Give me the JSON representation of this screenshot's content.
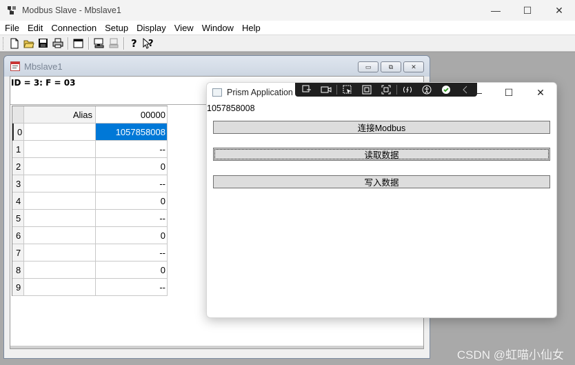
{
  "app": {
    "title": "Modbus Slave - Mbslave1",
    "minimize": "—",
    "maximize": "☐",
    "close": "✕"
  },
  "menu": [
    "File",
    "Edit",
    "Connection",
    "Setup",
    "Display",
    "View",
    "Window",
    "Help"
  ],
  "toolbar": {
    "icons": [
      "new-file-icon",
      "open-folder-icon",
      "save-icon",
      "print-icon",
      "window-icon",
      "connect-icon",
      "disconnect-icon",
      "help-icon",
      "context-help-icon"
    ]
  },
  "child_window": {
    "title": "Mbslave1",
    "id_line": "ID = 3: F = 03",
    "btn_min": "▭",
    "btn_restore": "⧉",
    "btn_close": "✕",
    "grid": {
      "headers": {
        "num": "",
        "alias": "Alias",
        "value": "00000"
      },
      "rows": [
        {
          "num": "0",
          "alias": "",
          "value": "1057858008"
        },
        {
          "num": "1",
          "alias": "",
          "value": "--"
        },
        {
          "num": "2",
          "alias": "",
          "value": "0"
        },
        {
          "num": "3",
          "alias": "",
          "value": "--"
        },
        {
          "num": "4",
          "alias": "",
          "value": "0"
        },
        {
          "num": "5",
          "alias": "",
          "value": "--"
        },
        {
          "num": "6",
          "alias": "",
          "value": "0"
        },
        {
          "num": "7",
          "alias": "",
          "value": "--"
        },
        {
          "num": "8",
          "alias": "",
          "value": "0"
        },
        {
          "num": "9",
          "alias": "",
          "value": "--"
        }
      ]
    }
  },
  "prism": {
    "title": "Prism Application",
    "value": "1057858008",
    "buttons": {
      "connect": "连接Modbus",
      "read": "读取数据",
      "write": "写入数据"
    },
    "minimize": "—",
    "maximize": "☐",
    "close": "✕"
  },
  "watermark": "CSDN @虹喵小仙女",
  "colors": {
    "selection": "#0078d7",
    "mdi_background": "#a9a9a9"
  }
}
